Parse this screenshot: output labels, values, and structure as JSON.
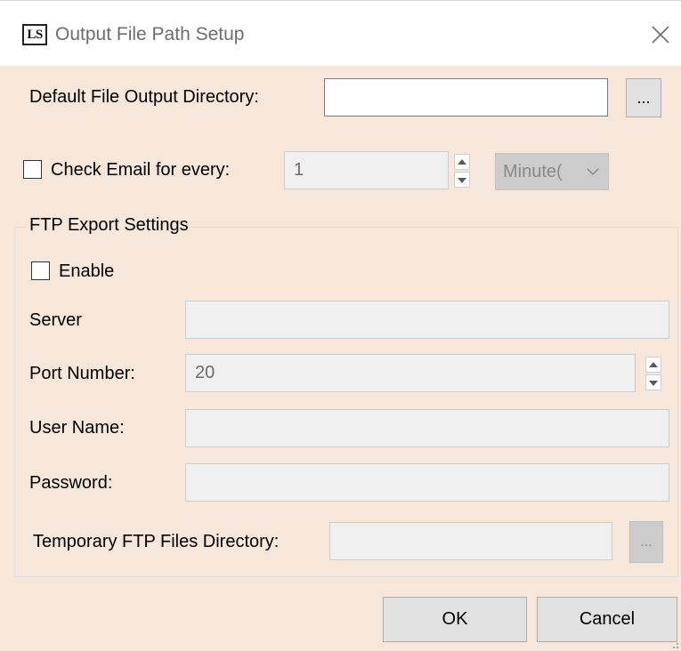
{
  "window": {
    "logo_text": "LS",
    "title": "Output File Path Setup",
    "close_icon": "close-icon"
  },
  "output": {
    "label": "Default File Output Directory:",
    "value": "",
    "browse_label": "..."
  },
  "email": {
    "label": "Check Email for every:",
    "checked": false,
    "interval_value": "1",
    "unit_value": "Minute("
  },
  "ftp": {
    "group_title": "FTP Export Settings",
    "enable_label": "Enable",
    "enable_checked": false,
    "server_label": "Server",
    "server_value": "",
    "port_label": "Port Number:",
    "port_value": "20",
    "user_label": "User Name:",
    "user_value": "",
    "password_label": "Password:",
    "password_value": "",
    "temp_dir_label": "Temporary FTP Files Directory:",
    "temp_dir_value": "",
    "temp_browse_label": "..."
  },
  "footer": {
    "ok_label": "OK",
    "cancel_label": "Cancel"
  },
  "colors": {
    "client_background": "#f6e7da",
    "disabled_field": "#f0f0f0",
    "button_face": "#e1e1e1"
  }
}
